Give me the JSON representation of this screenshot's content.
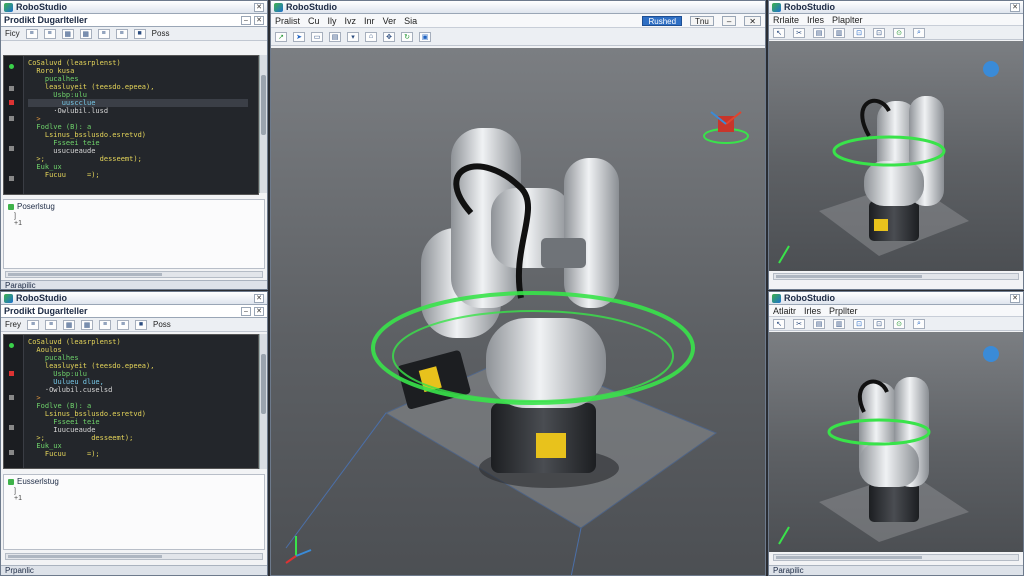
{
  "windows": {
    "code_top": {
      "title": "RoboStudio",
      "panel_title": "Prodikt Dugarlteller",
      "menu": [
        "Ficy",
        "Teol",
        "Ficle"
      ],
      "toolbar_label": "Poss",
      "props_title": "Poserlstug",
      "props_rows": [
        "]",
        "+1"
      ],
      "status": "Parapilic"
    },
    "code_bottom": {
      "title": "RoboStudio",
      "panel_title": "Prodikt Dugarlteller",
      "menu": [
        "Frey",
        "Teol",
        "Ficle"
      ],
      "toolbar_label": "Poss",
      "props_title": "Eusserlstug",
      "props_rows": [
        "]",
        "+1"
      ],
      "status": "Prpanlic"
    },
    "main": {
      "title": "RoboStudio",
      "menu": [
        "Pralist",
        "Cu",
        "Ily",
        "Ivz",
        "Inr",
        "Ver",
        "Sia"
      ],
      "accent_button": "Rushed",
      "plain_button": "Tnu"
    },
    "side_top": {
      "title": "RoboStudio",
      "menu": [
        "Rrlaite",
        "Irles",
        "Plaplter"
      ]
    },
    "side_bottom": {
      "title": "RoboStudio",
      "menu": [
        "Atlaitr",
        "Irles",
        "Prpllter"
      ],
      "status": "Parapilic"
    }
  },
  "code_snippets": {
    "top": [
      {
        "t": "CoSaluvd (leasrplenst)",
        "c": "c-y"
      },
      {
        "t": "  Roro kusa",
        "c": "c-y"
      },
      {
        "t": "    pucalhes",
        "c": "c-g"
      },
      {
        "t": "    leasluyeit (teesdo.epeea),",
        "c": "c-y"
      },
      {
        "t": "      Usbp:ulu",
        "c": "c-g"
      },
      {
        "t": "        uuscclue",
        "c": "c-c"
      },
      {
        "t": "      ·Owlubil.lusd",
        "c": "c-w"
      },
      {
        "t": "  >",
        "c": "c-o"
      },
      {
        "t": "  Fodlve (B): a",
        "c": "c-g"
      },
      {
        "t": "    Lsinus_bsslusdo.esretvd)",
        "c": "c-y"
      },
      {
        "t": "      Fsseei teie",
        "c": "c-g"
      },
      {
        "t": "      usucueaude",
        "c": "c-w"
      },
      {
        "t": "  >;             desseemt);",
        "c": "c-y"
      },
      {
        "t": "  Euk_ux",
        "c": "c-g"
      },
      {
        "t": "    Fucuu     =);",
        "c": "c-y"
      }
    ],
    "bottom": [
      {
        "t": "CoSaluvd (leasrplenst)",
        "c": "c-y"
      },
      {
        "t": "  Aoulos",
        "c": "c-y"
      },
      {
        "t": "    pucalhes",
        "c": "c-g"
      },
      {
        "t": "    leasluyeit (teesdo.epeea),",
        "c": "c-y"
      },
      {
        "t": "      Usbp:ulu",
        "c": "c-g"
      },
      {
        "t": "      Uulueu dlue,",
        "c": "c-c"
      },
      {
        "t": "    ·Owlubil.cuselsd",
        "c": "c-w"
      },
      {
        "t": "  >",
        "c": "c-o"
      },
      {
        "t": "  Fodlve (B): a",
        "c": "c-g"
      },
      {
        "t": "    Lsinus_bsslusdo.esretvd)",
        "c": "c-y"
      },
      {
        "t": "      Fsseei teie",
        "c": "c-g"
      },
      {
        "t": "      Iuucueaude",
        "c": "c-w"
      },
      {
        "t": "  >;           desseemt);",
        "c": "c-y"
      },
      {
        "t": "  Euk_ux",
        "c": "c-g"
      },
      {
        "t": "    Fucuu     =);",
        "c": "c-y"
      }
    ]
  },
  "icons": {
    "toolbar": [
      "arrow-icon",
      "cursor-icon",
      "folder-icon",
      "grid-icon",
      "home-icon",
      "move-icon",
      "rotate-icon",
      "save-icon"
    ],
    "side": [
      "select-icon",
      "cut-icon",
      "copy-icon",
      "paste-icon",
      "target-icon",
      "target-icon",
      "sync-icon",
      "zoom-icon"
    ]
  },
  "colors": {
    "ring": "#39e34a",
    "robot": "#c8ccd1",
    "accent": "#2f6fc4"
  }
}
